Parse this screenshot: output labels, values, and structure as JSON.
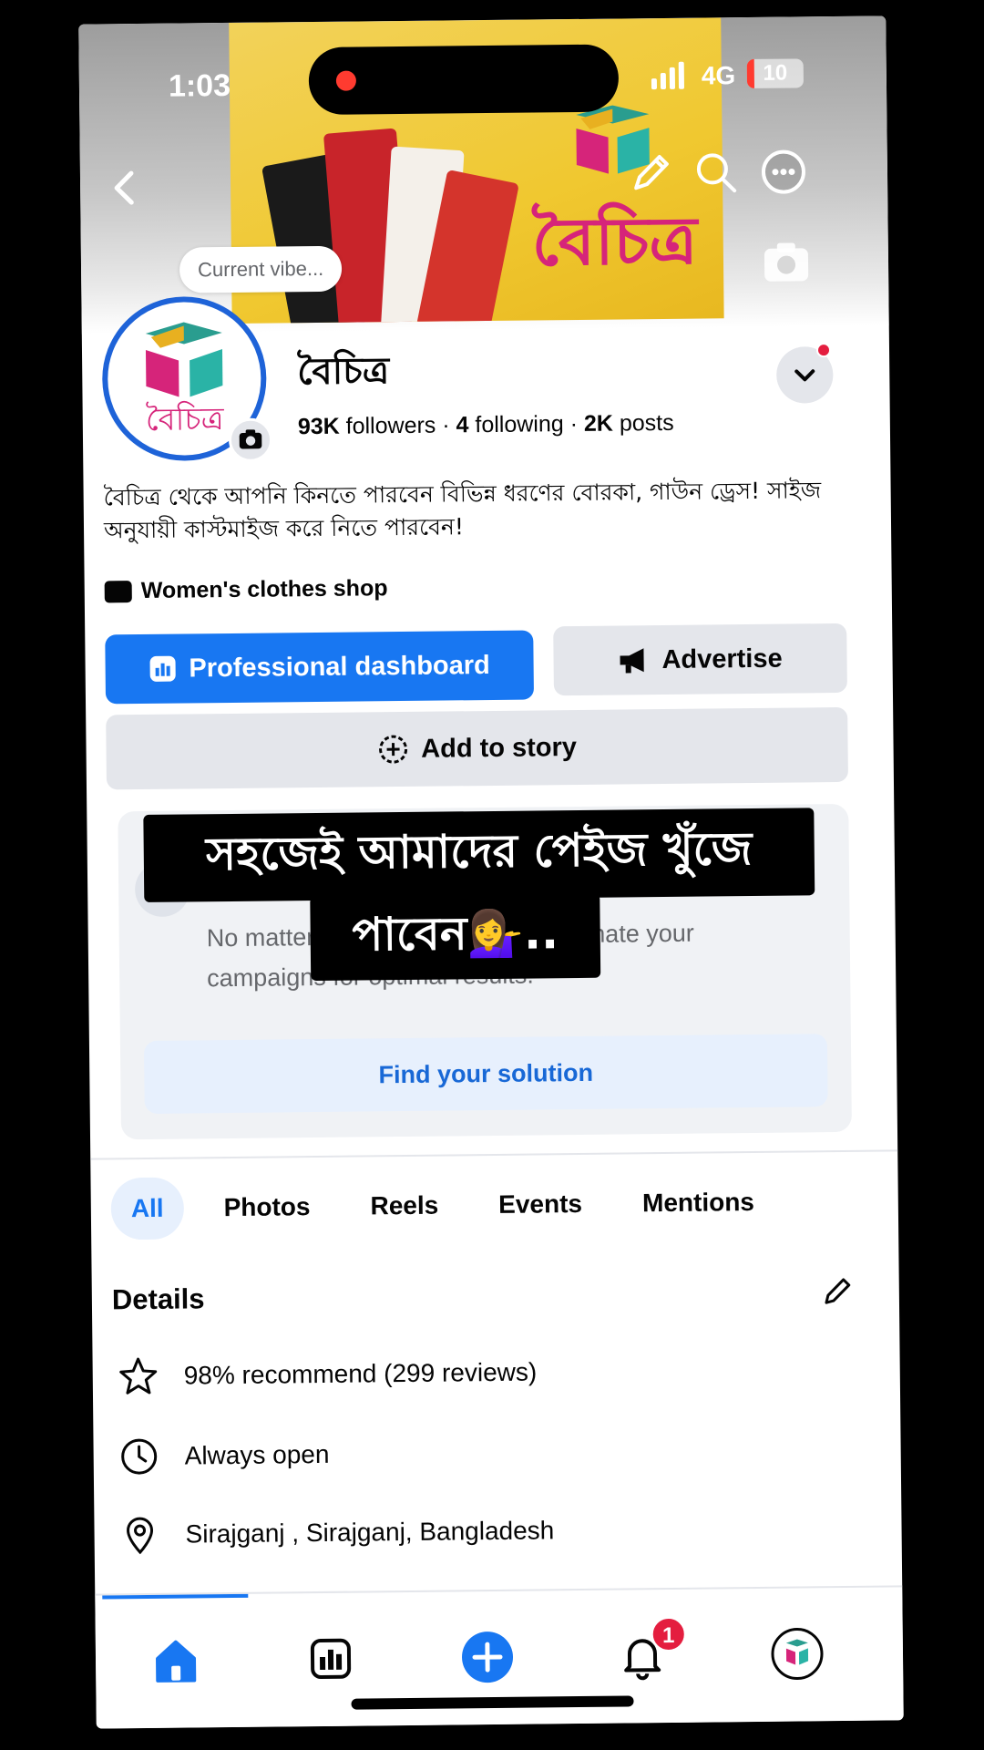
{
  "status_bar": {
    "time": "1:03",
    "network": "4G",
    "battery": "10"
  },
  "cover": {
    "logo_text": "বৈচিত্র",
    "vibe_placeholder": "Current vibe..."
  },
  "profile": {
    "name": "বৈচিত্র",
    "followers_count": "93K",
    "followers_label": "followers",
    "following_count": "4",
    "following_label": "following",
    "posts_count": "2K",
    "posts_label": "posts",
    "sep": "·",
    "bio": "বৈচিত্র থেকে আপনি কিনতে পারবেন বিভিন্ন ধরণের বোরকা, গাউন ড্রেস! সাইজ অনুযায়ী কাস্টমাইজ করে নিতে পারবেন!",
    "category": "Women's clothes shop"
  },
  "actions": {
    "dashboard": "Professional dashboard",
    "advertise": "Advertise",
    "add_story": "Add to story"
  },
  "ad_card": {
    "text": "No matter … Advantage+ can automate your campaigns for optimal results.",
    "button": "Find your solution"
  },
  "overlay": {
    "line1": "সহজেই আমাদের পেইজ খুঁজে",
    "line2": "পাবেন💁‍♀️.."
  },
  "tabs": [
    "All",
    "Photos",
    "Reels",
    "Events",
    "Mentions"
  ],
  "details": {
    "title": "Details",
    "recommend": "98% recommend (299 reviews)",
    "hours": "Always open",
    "location": "Sirajganj , Sirajganj, Bangladesh"
  },
  "bottom_nav": {
    "notification_count": "1"
  },
  "colors": {
    "accent": "#1877f2",
    "badge": "#e41e3f",
    "brand_pink": "#d6247a"
  }
}
